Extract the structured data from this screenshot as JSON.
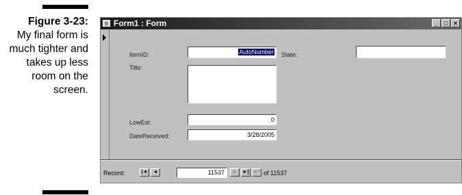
{
  "caption": {
    "label": "Figure 3-23:",
    "body": "My final form is much tighter and takes up less room on the screen."
  },
  "window": {
    "title": "Form1 : Form",
    "buttons": {
      "minimize": "_",
      "maximize": "□",
      "close": "×"
    }
  },
  "form": {
    "item_id_label": "ItemID:",
    "item_id_value": "AutoNumber",
    "state_label": "State:",
    "state_value": "",
    "title_label": "Title:",
    "title_value": "",
    "low_est_label": "LowEst:",
    "low_est_value": "0",
    "date_received_label": "DateReceived:",
    "date_received_value": "3/28/2005"
  },
  "navigation": {
    "record_label": "Record:",
    "first": "|◄",
    "prev": "◄",
    "current_record": "11537",
    "next": "►",
    "last": "►|",
    "new": "►*",
    "total_text": "of  11537"
  }
}
